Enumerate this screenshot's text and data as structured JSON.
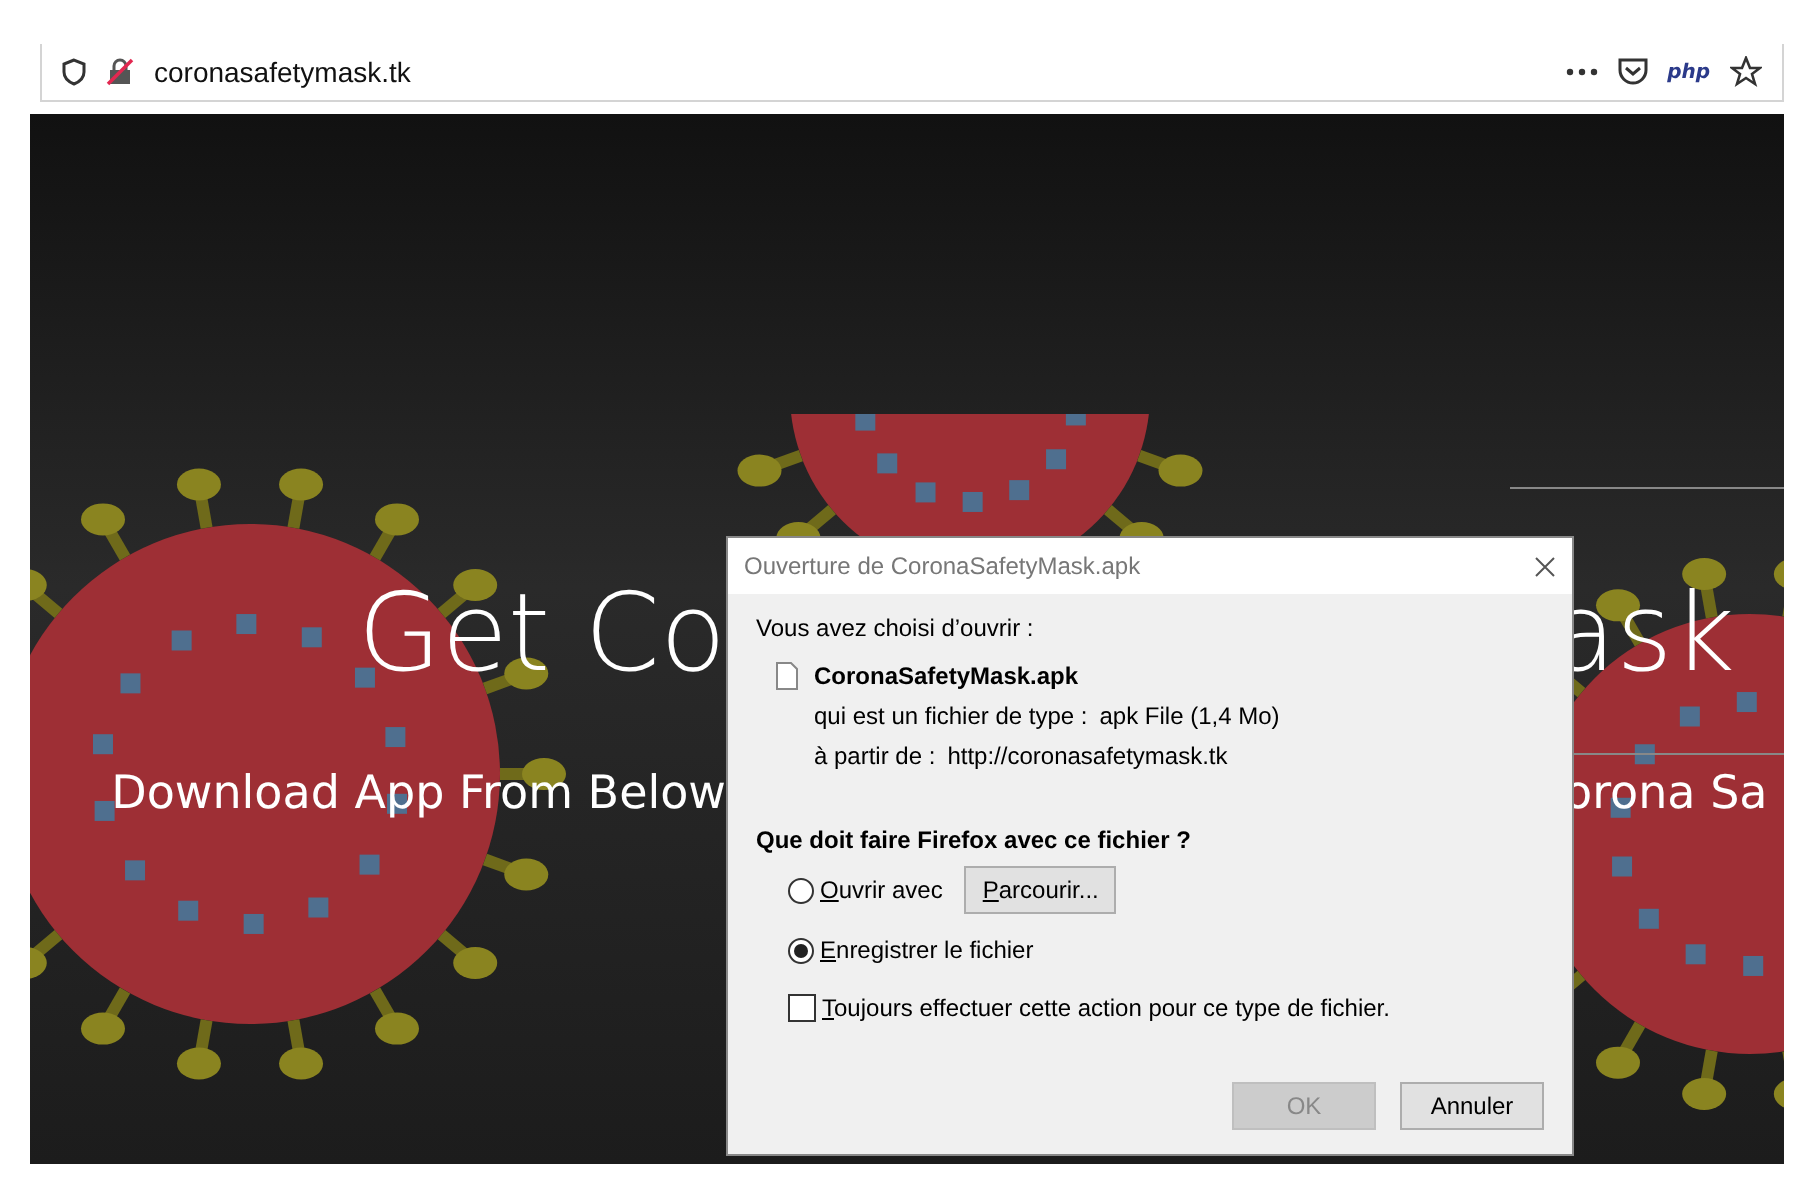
{
  "browser": {
    "url": "coronasafetymask.tk",
    "php_label": "php"
  },
  "hero": {
    "heading_left": "Get Co",
    "heading_right": "ask",
    "subtitle_left": "Download App From Below",
    "subtitle_right": "orona Sa"
  },
  "dialog": {
    "title": "Ouverture de CoronaSafetyMask.apk",
    "intro": "Vous avez choisi d’ouvrir :",
    "file_name": "CoronaSafetyMask.apk",
    "details": [
      {
        "label": "qui est un fichier de type :",
        "value": "apk File (1,4 Mo)"
      },
      {
        "label": "à partir de :",
        "value": "http://coronasafetymask.tk"
      }
    ],
    "question": "Que doit faire Firefox avec ce fichier ?",
    "options": [
      {
        "label": "Ouvrir avec",
        "selected": false,
        "browse": "Parcourir..."
      },
      {
        "label": "Enregistrer le fichier",
        "selected": true
      }
    ],
    "always": {
      "label": "Toujours effectuer cette action pour ce type de fichier.",
      "checked": false
    },
    "buttons": [
      {
        "label": "OK",
        "disabled": true
      },
      {
        "label": "Annuler",
        "disabled": false
      }
    ]
  }
}
